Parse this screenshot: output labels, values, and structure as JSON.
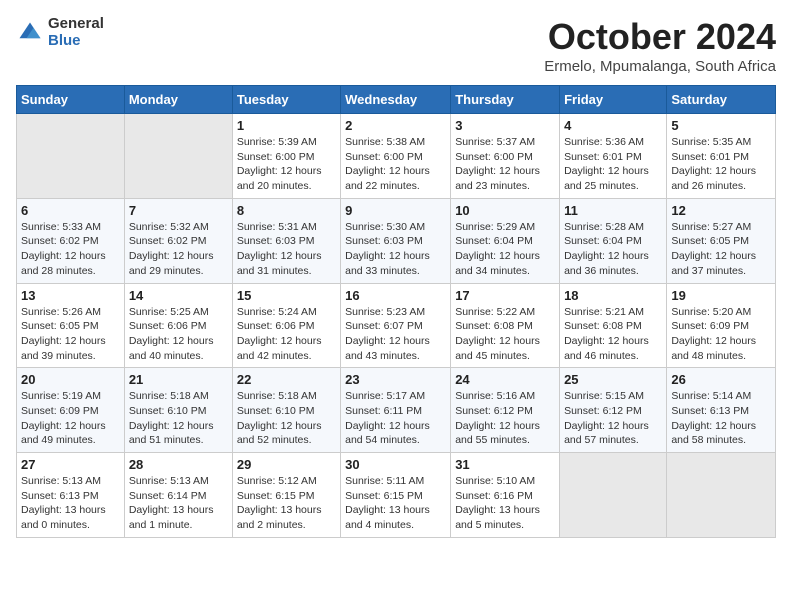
{
  "header": {
    "logo_general": "General",
    "logo_blue": "Blue",
    "title": "October 2024",
    "subtitle": "Ermelo, Mpumalanga, South Africa"
  },
  "weekdays": [
    "Sunday",
    "Monday",
    "Tuesday",
    "Wednesday",
    "Thursday",
    "Friday",
    "Saturday"
  ],
  "weeks": [
    [
      {
        "day": "",
        "empty": true
      },
      {
        "day": "",
        "empty": true
      },
      {
        "day": "1",
        "sunrise": "5:39 AM",
        "sunset": "6:00 PM",
        "daylight": "12 hours and 20 minutes."
      },
      {
        "day": "2",
        "sunrise": "5:38 AM",
        "sunset": "6:00 PM",
        "daylight": "12 hours and 22 minutes."
      },
      {
        "day": "3",
        "sunrise": "5:37 AM",
        "sunset": "6:00 PM",
        "daylight": "12 hours and 23 minutes."
      },
      {
        "day": "4",
        "sunrise": "5:36 AM",
        "sunset": "6:01 PM",
        "daylight": "12 hours and 25 minutes."
      },
      {
        "day": "5",
        "sunrise": "5:35 AM",
        "sunset": "6:01 PM",
        "daylight": "12 hours and 26 minutes."
      }
    ],
    [
      {
        "day": "6",
        "sunrise": "5:33 AM",
        "sunset": "6:02 PM",
        "daylight": "12 hours and 28 minutes."
      },
      {
        "day": "7",
        "sunrise": "5:32 AM",
        "sunset": "6:02 PM",
        "daylight": "12 hours and 29 minutes."
      },
      {
        "day": "8",
        "sunrise": "5:31 AM",
        "sunset": "6:03 PM",
        "daylight": "12 hours and 31 minutes."
      },
      {
        "day": "9",
        "sunrise": "5:30 AM",
        "sunset": "6:03 PM",
        "daylight": "12 hours and 33 minutes."
      },
      {
        "day": "10",
        "sunrise": "5:29 AM",
        "sunset": "6:04 PM",
        "daylight": "12 hours and 34 minutes."
      },
      {
        "day": "11",
        "sunrise": "5:28 AM",
        "sunset": "6:04 PM",
        "daylight": "12 hours and 36 minutes."
      },
      {
        "day": "12",
        "sunrise": "5:27 AM",
        "sunset": "6:05 PM",
        "daylight": "12 hours and 37 minutes."
      }
    ],
    [
      {
        "day": "13",
        "sunrise": "5:26 AM",
        "sunset": "6:05 PM",
        "daylight": "12 hours and 39 minutes."
      },
      {
        "day": "14",
        "sunrise": "5:25 AM",
        "sunset": "6:06 PM",
        "daylight": "12 hours and 40 minutes."
      },
      {
        "day": "15",
        "sunrise": "5:24 AM",
        "sunset": "6:06 PM",
        "daylight": "12 hours and 42 minutes."
      },
      {
        "day": "16",
        "sunrise": "5:23 AM",
        "sunset": "6:07 PM",
        "daylight": "12 hours and 43 minutes."
      },
      {
        "day": "17",
        "sunrise": "5:22 AM",
        "sunset": "6:08 PM",
        "daylight": "12 hours and 45 minutes."
      },
      {
        "day": "18",
        "sunrise": "5:21 AM",
        "sunset": "6:08 PM",
        "daylight": "12 hours and 46 minutes."
      },
      {
        "day": "19",
        "sunrise": "5:20 AM",
        "sunset": "6:09 PM",
        "daylight": "12 hours and 48 minutes."
      }
    ],
    [
      {
        "day": "20",
        "sunrise": "5:19 AM",
        "sunset": "6:09 PM",
        "daylight": "12 hours and 49 minutes."
      },
      {
        "day": "21",
        "sunrise": "5:18 AM",
        "sunset": "6:10 PM",
        "daylight": "12 hours and 51 minutes."
      },
      {
        "day": "22",
        "sunrise": "5:18 AM",
        "sunset": "6:10 PM",
        "daylight": "12 hours and 52 minutes."
      },
      {
        "day": "23",
        "sunrise": "5:17 AM",
        "sunset": "6:11 PM",
        "daylight": "12 hours and 54 minutes."
      },
      {
        "day": "24",
        "sunrise": "5:16 AM",
        "sunset": "6:12 PM",
        "daylight": "12 hours and 55 minutes."
      },
      {
        "day": "25",
        "sunrise": "5:15 AM",
        "sunset": "6:12 PM",
        "daylight": "12 hours and 57 minutes."
      },
      {
        "day": "26",
        "sunrise": "5:14 AM",
        "sunset": "6:13 PM",
        "daylight": "12 hours and 58 minutes."
      }
    ],
    [
      {
        "day": "27",
        "sunrise": "5:13 AM",
        "sunset": "6:13 PM",
        "daylight": "13 hours and 0 minutes."
      },
      {
        "day": "28",
        "sunrise": "5:13 AM",
        "sunset": "6:14 PM",
        "daylight": "13 hours and 1 minute."
      },
      {
        "day": "29",
        "sunrise": "5:12 AM",
        "sunset": "6:15 PM",
        "daylight": "13 hours and 2 minutes."
      },
      {
        "day": "30",
        "sunrise": "5:11 AM",
        "sunset": "6:15 PM",
        "daylight": "13 hours and 4 minutes."
      },
      {
        "day": "31",
        "sunrise": "5:10 AM",
        "sunset": "6:16 PM",
        "daylight": "13 hours and 5 minutes."
      },
      {
        "day": "",
        "empty": true
      },
      {
        "day": "",
        "empty": true
      }
    ]
  ],
  "labels": {
    "sunrise": "Sunrise:",
    "sunset": "Sunset:",
    "daylight": "Daylight:"
  }
}
